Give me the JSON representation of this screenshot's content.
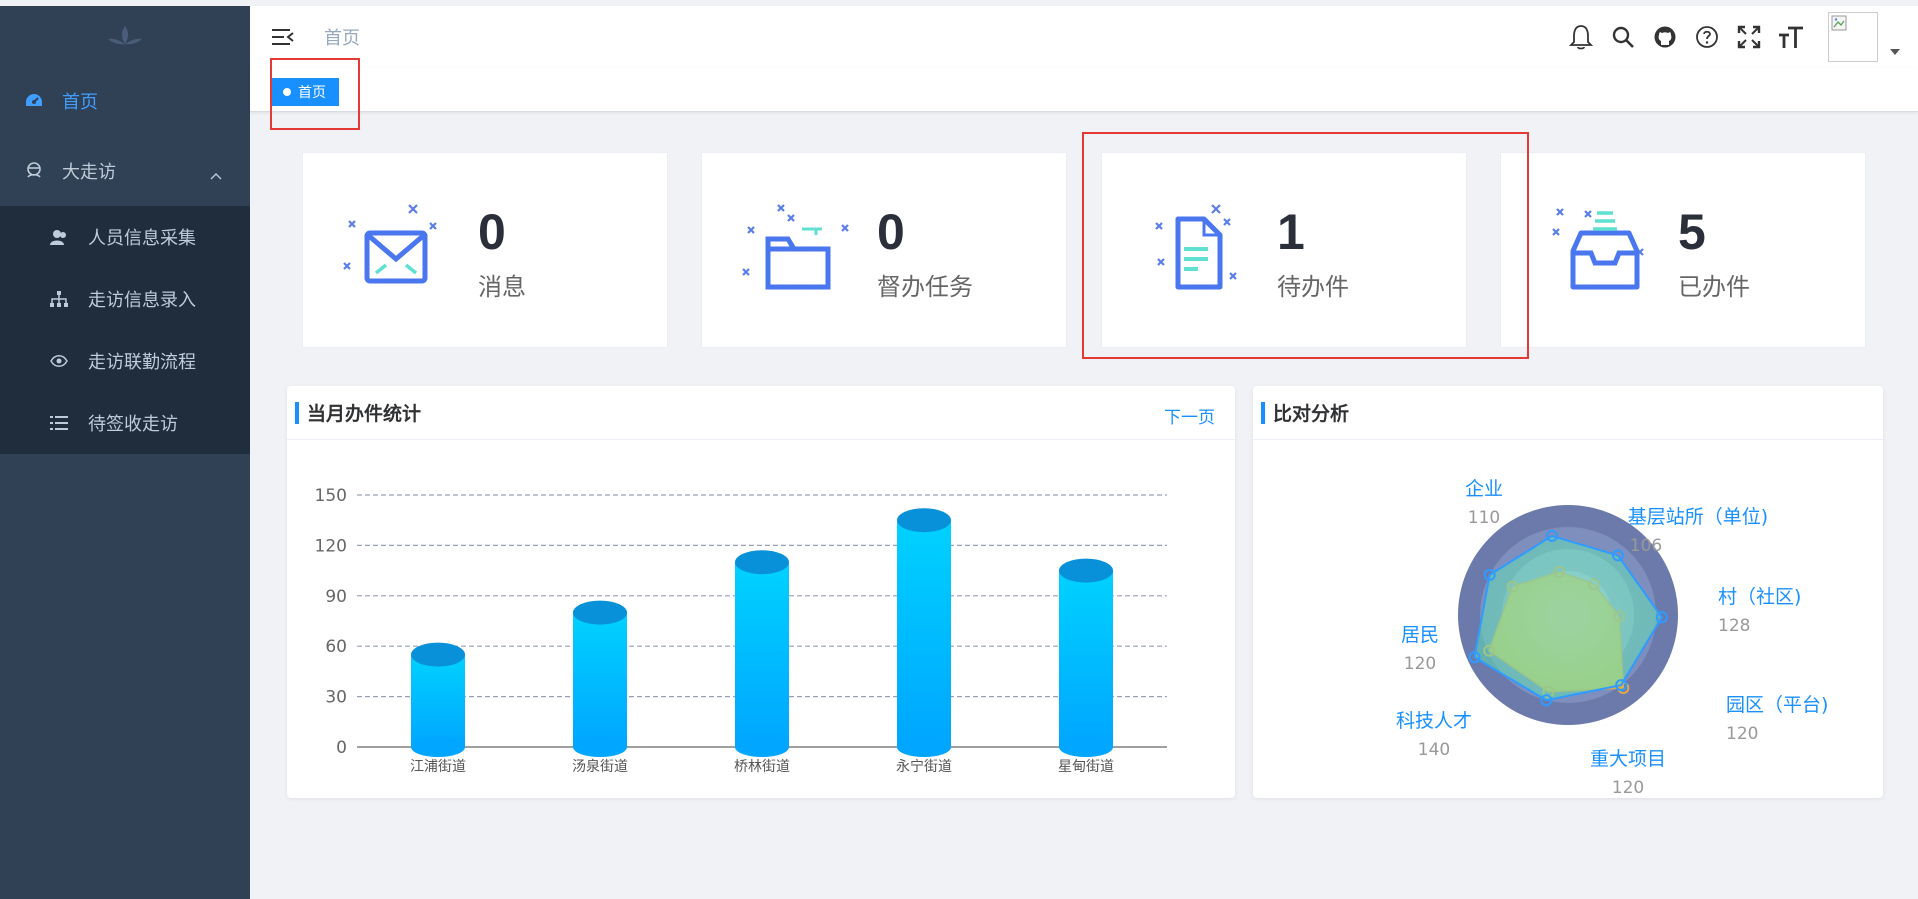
{
  "sidebar": {
    "items": [
      {
        "label": "首页",
        "icon": "dashboard-icon",
        "active": true
      },
      {
        "label": "大走访",
        "icon": "visit-icon",
        "expanded": true,
        "children": [
          {
            "label": "人员信息采集",
            "icon": "peoples-icon"
          },
          {
            "label": "走访信息录入",
            "icon": "tree-icon"
          },
          {
            "label": "走访联勤流程",
            "icon": "eye-icon"
          },
          {
            "label": "待签收走访",
            "icon": "list-icon"
          }
        ]
      }
    ]
  },
  "header": {
    "breadcrumb": "首页",
    "icons": [
      "bell-icon",
      "search-icon",
      "github-icon",
      "question-icon",
      "fullscreen-icon",
      "font-size-icon"
    ]
  },
  "tags": {
    "active": "首页"
  },
  "cards": [
    {
      "value": "0",
      "label": "消息",
      "icon": "mail-icon"
    },
    {
      "value": "0",
      "label": "督办任务",
      "icon": "folder-icon"
    },
    {
      "value": "1",
      "label": "待办件",
      "icon": "document-icon"
    },
    {
      "value": "5",
      "label": "已办件",
      "icon": "inbox-icon"
    }
  ],
  "bar_panel": {
    "title": "当月办件统计",
    "link": "下一页"
  },
  "radar_panel": {
    "title": "比对分析"
  },
  "colors": {
    "accent": "#1890ff",
    "sidebar": "#304156",
    "sidebar_sub": "#1f2d3d",
    "highlight": "#e53935"
  },
  "chart_data": [
    {
      "type": "bar",
      "categories": [
        "江浦街道",
        "汤泉街道",
        "桥林街道",
        "永宁街道",
        "星甸街道"
      ],
      "values": [
        55,
        80,
        110,
        135,
        105
      ],
      "ylim": [
        0,
        150
      ],
      "yticks": [
        0,
        30,
        60,
        90,
        120,
        150
      ],
      "grid": true
    },
    {
      "type": "radar",
      "indicators": [
        {
          "name": "企业",
          "value": 110
        },
        {
          "name": "基层站所（单位)",
          "value": 106
        },
        {
          "name": "村（社区)",
          "value": 128
        },
        {
          "name": "园区（平台)",
          "value": 120
        },
        {
          "name": "重大项目",
          "value": 120
        },
        {
          "name": "科技人才",
          "value": 140
        },
        {
          "name": "居民",
          "value": 120
        }
      ],
      "series": [
        {
          "values": [
            110,
            106,
            128,
            120,
            120,
            140,
            120
          ],
          "color": "#2f9bff"
        },
        {
          "values": [
            60,
            55,
            70,
            125,
            108,
            118,
            85
          ],
          "color": "#e8c547"
        }
      ]
    }
  ]
}
